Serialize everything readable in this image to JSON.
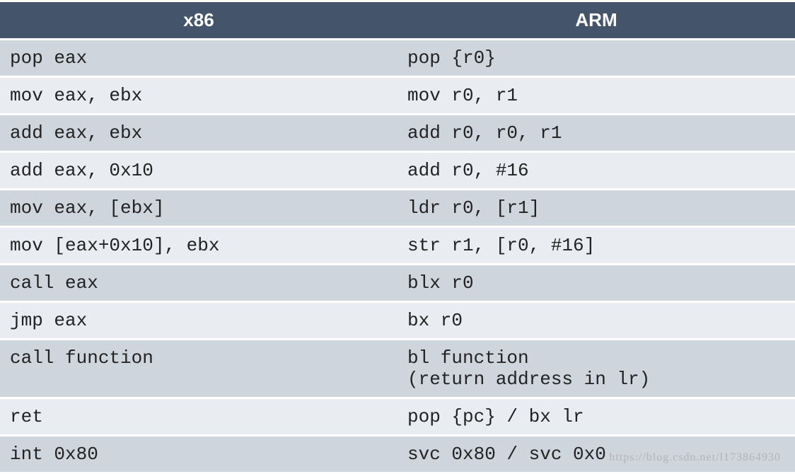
{
  "headers": {
    "col1": "x86",
    "col2": "ARM"
  },
  "rows": [
    {
      "x86": "pop eax",
      "arm": "pop {r0}"
    },
    {
      "x86": "mov eax, ebx",
      "arm": "mov r0, r1"
    },
    {
      "x86": "add eax, ebx",
      "arm": "add r0, r0, r1"
    },
    {
      "x86": "add eax, 0x10",
      "arm": "add r0, #16"
    },
    {
      "x86": "mov eax, [ebx]",
      "arm": "ldr r0, [r1]"
    },
    {
      "x86": "mov [eax+0x10], ebx",
      "arm": "str r1, [r0, #16]"
    },
    {
      "x86": "call eax",
      "arm": "blx r0"
    },
    {
      "x86": "jmp eax",
      "arm": "bx r0"
    },
    {
      "x86": "call function",
      "arm": "bl function\n(return address in lr)"
    },
    {
      "x86": "ret",
      "arm": "pop {pc} / bx lr"
    },
    {
      "x86": "int 0x80",
      "arm": "svc 0x80 / svc 0x0"
    }
  ],
  "watermark": "https://blog.csdn.net/l173864930",
  "chart_data": {
    "type": "table",
    "columns": [
      "x86",
      "ARM"
    ],
    "rows": [
      [
        "pop eax",
        "pop {r0}"
      ],
      [
        "mov eax, ebx",
        "mov r0, r1"
      ],
      [
        "add eax, ebx",
        "add r0, r0, r1"
      ],
      [
        "add eax, 0x10",
        "add r0, #16"
      ],
      [
        "mov eax, [ebx]",
        "ldr r0, [r1]"
      ],
      [
        "mov [eax+0x10], ebx",
        "str r1, [r0, #16]"
      ],
      [
        "call eax",
        "blx r0"
      ],
      [
        "jmp eax",
        "bx r0"
      ],
      [
        "call function",
        "bl function (return address in lr)"
      ],
      [
        "ret",
        "pop {pc} / bx lr"
      ],
      [
        "int 0x80",
        "svc 0x80 / svc 0x0"
      ]
    ]
  }
}
